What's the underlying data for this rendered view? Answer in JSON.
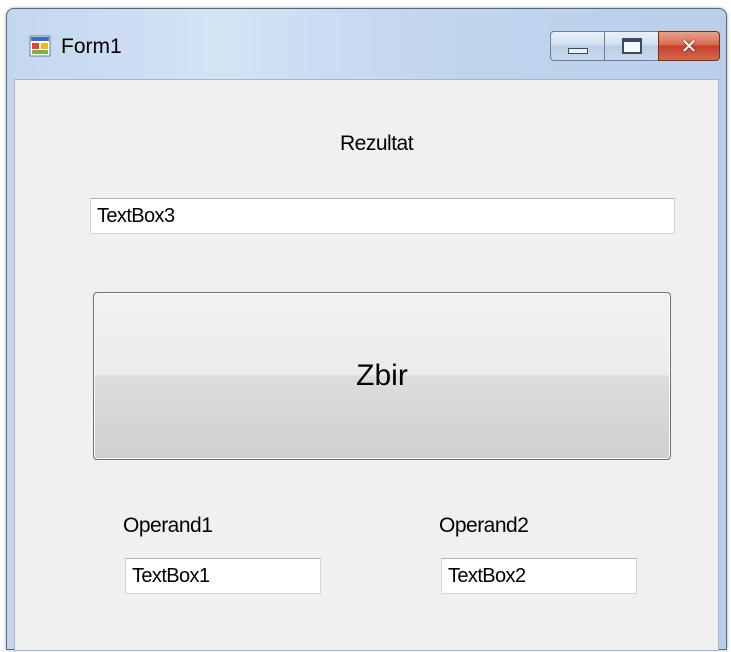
{
  "window": {
    "title": "Form1",
    "icon": "form-app-icon",
    "controls": {
      "minimize": "minimize-icon",
      "maximize": "maximize-icon",
      "close": "close-icon",
      "close_glyph": "✕"
    }
  },
  "form": {
    "result_label": "Rezultat",
    "result_textbox": "TextBox3",
    "sum_button": "Zbir",
    "operand1_label": "Operand1",
    "operand1_textbox": "TextBox1",
    "operand2_label": "Operand2",
    "operand2_textbox": "TextBox2"
  },
  "colors": {
    "client_background": "#f0f0f0",
    "close_button": "#c4402a",
    "titlebar": "#c4d7ef"
  }
}
